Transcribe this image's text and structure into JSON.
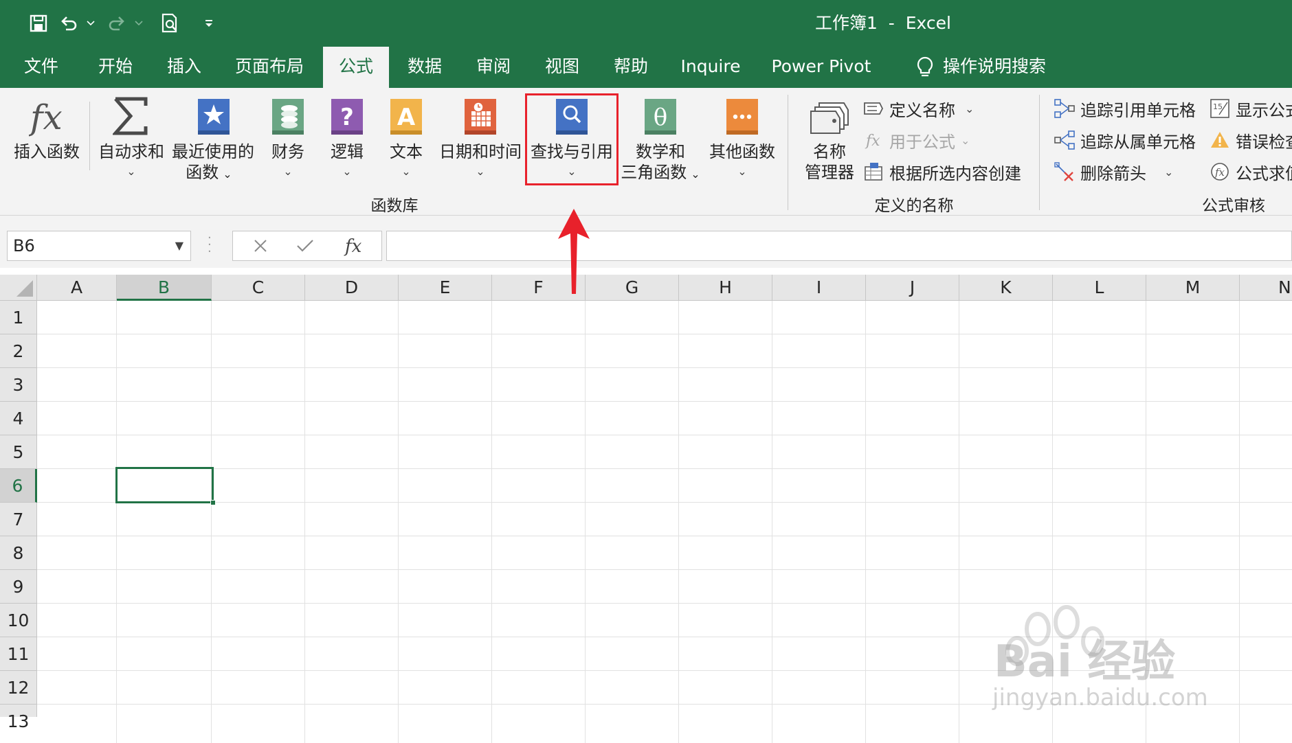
{
  "window": {
    "title": "工作簿1  -  Excel"
  },
  "qat": {
    "icons": [
      "save-icon",
      "undo-icon",
      "redo-icon",
      "print-preview-icon",
      "customize-qat-icon"
    ]
  },
  "tabs": [
    {
      "label": "文件"
    },
    {
      "label": "开始"
    },
    {
      "label": "插入"
    },
    {
      "label": "页面布局"
    },
    {
      "label": "公式"
    },
    {
      "label": "数据"
    },
    {
      "label": "审阅"
    },
    {
      "label": "视图"
    },
    {
      "label": "帮助"
    },
    {
      "label": "Inquire"
    },
    {
      "label": "Power Pivot"
    },
    {
      "label": "操作说明搜索"
    }
  ],
  "active_tab": "公式",
  "ribbon": {
    "function_library": {
      "group_label": "函数库",
      "insert_function": "插入函数",
      "autosum": "自动求和",
      "recent_line1": "最近使用的",
      "recent_line2": "函数",
      "financial": "财务",
      "logical": "逻辑",
      "text": "文本",
      "datetime": "日期和时间",
      "lookup": "查找与引用",
      "math_line1": "数学和",
      "math_line2": "三角函数",
      "more": "其他函数"
    },
    "defined_names": {
      "group_label": "定义的名称",
      "name_manager_line1": "名称",
      "name_manager_line2": "管理器",
      "define_name": "定义名称",
      "use_in_formula": "用于公式",
      "create_from_selection": "根据所选内容创建"
    },
    "formula_auditing": {
      "group_label": "公式审核",
      "trace_precedents": "追踪引用单元格",
      "trace_dependents": "追踪从属单元格",
      "remove_arrows": "删除箭头",
      "show_formulas": "显示公式",
      "error_checking": "错误检查",
      "evaluate_formula": "公式求值"
    }
  },
  "formula_bar": {
    "name_box": "B6",
    "fx_label": "fx",
    "value": ""
  },
  "sheet": {
    "columns": [
      "A",
      "B",
      "C",
      "D",
      "E",
      "F",
      "G",
      "H",
      "I",
      "J",
      "K",
      "L",
      "M",
      "N"
    ],
    "rows": [
      "1",
      "2",
      "3",
      "4",
      "5",
      "6",
      "7",
      "8",
      "9",
      "10",
      "11",
      "12",
      "13"
    ],
    "selected_column": "B",
    "selected_row": "6"
  },
  "watermark": {
    "main": "Bai 经验",
    "sub": "jingyan.baidu.com"
  },
  "colors": {
    "excel_green": "#217346",
    "highlight_red": "#e8212b"
  }
}
